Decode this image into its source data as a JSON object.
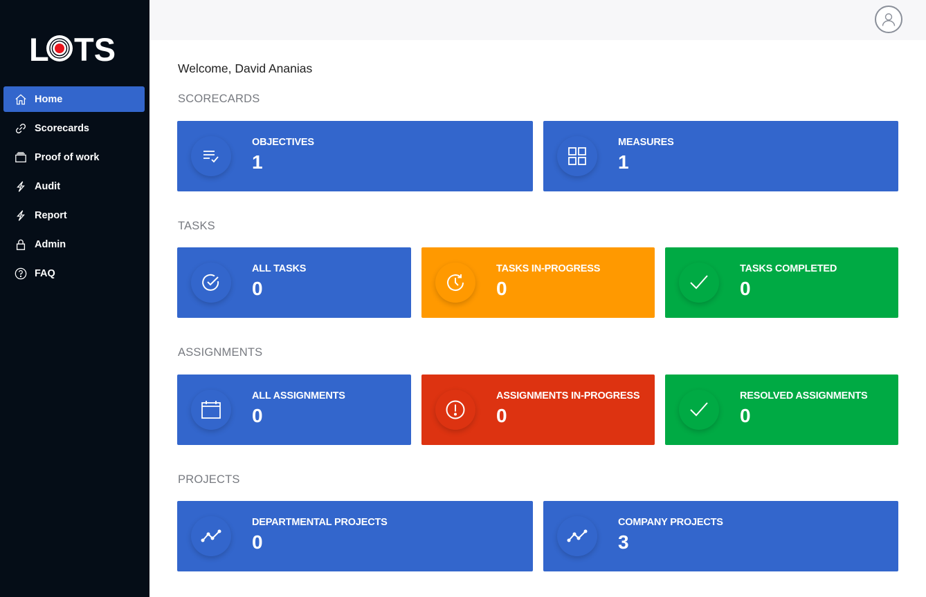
{
  "app": {
    "logo_text": "LOTS"
  },
  "sidebar": {
    "items": [
      {
        "label": "Home",
        "icon": "home-icon",
        "active": true
      },
      {
        "label": "Scorecards",
        "icon": "link-icon"
      },
      {
        "label": "Proof of work",
        "icon": "tray-icon"
      },
      {
        "label": "Audit",
        "icon": "lightning-icon"
      },
      {
        "label": "Report",
        "icon": "lightning-icon"
      },
      {
        "label": "Admin",
        "icon": "lock-icon"
      },
      {
        "label": "FAQ",
        "icon": "question-circle-icon"
      }
    ]
  },
  "header": {
    "user_icon": "user-avatar-icon"
  },
  "main": {
    "welcome": "Welcome, David Ananias",
    "sections": {
      "scorecards": {
        "title": "SCORECARDS",
        "cards": [
          {
            "label": "OBJECTIVES",
            "value": "1",
            "color": "#3366cc",
            "icon": "list-check-icon"
          },
          {
            "label": "MEASURES",
            "value": "1",
            "color": "#3366cc",
            "icon": "grid-icon"
          }
        ]
      },
      "tasks": {
        "title": "TASKS",
        "cards": [
          {
            "label": "ALL TASKS",
            "value": "0",
            "color": "#3366cc",
            "icon": "check-circle-icon"
          },
          {
            "label": "TASKS IN-PROGRESS",
            "value": "0",
            "color": "#ff9900",
            "icon": "clock-refresh-icon"
          },
          {
            "label": "TASKS COMPLETED",
            "value": "0",
            "color": "#00aa44",
            "icon": "checkmark-icon"
          }
        ]
      },
      "assignments": {
        "title": "ASSIGNMENTS",
        "cards": [
          {
            "label": "ALL ASSIGNMENTS",
            "value": "0",
            "color": "#3366cc",
            "icon": "calendar-icon"
          },
          {
            "label": "ASSIGNMENTS IN-PROGRESS",
            "value": "0",
            "color": "#dd3311",
            "icon": "exclamation-circle-icon"
          },
          {
            "label": "RESOLVED ASSIGNMENTS",
            "value": "0",
            "color": "#00aa44",
            "icon": "checkmark-icon"
          }
        ]
      },
      "projects": {
        "title": "PROJECTS",
        "cards": [
          {
            "label": "DEPARTMENTAL PROJECTS",
            "value": "0",
            "color": "#3366cc",
            "icon": "trend-line-icon"
          },
          {
            "label": "COMPANY PROJECTS",
            "value": "3",
            "color": "#3366cc",
            "icon": "trend-line-icon"
          }
        ]
      }
    }
  }
}
